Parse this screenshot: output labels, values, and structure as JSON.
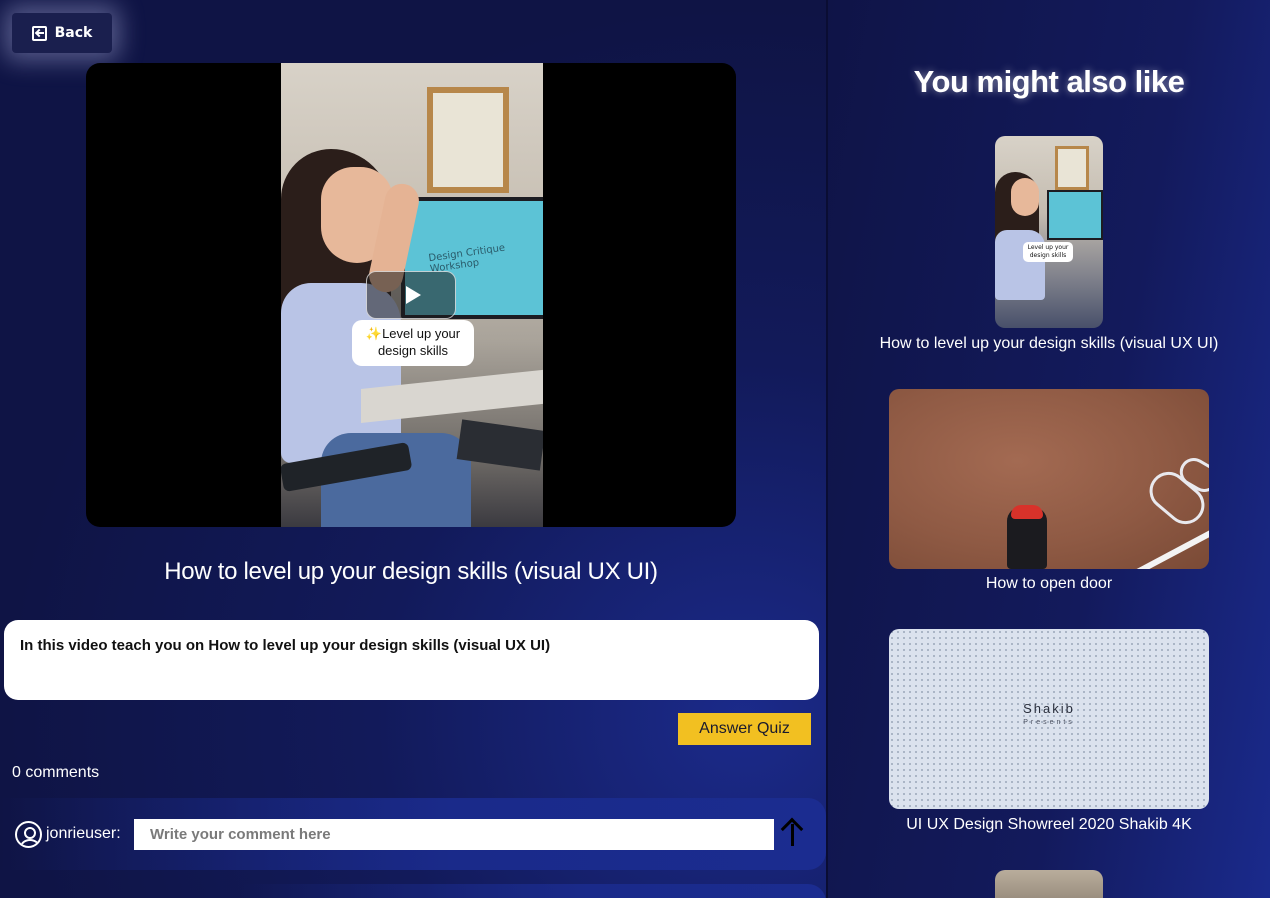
{
  "back_button": {
    "label": "Back",
    "icon": "arrow-left-square-icon"
  },
  "video": {
    "caption_emoji": "✨",
    "caption_text": "Level up your design skills",
    "monitor_text": "Design Critique Workshop",
    "title": "How to level up your design skills (visual UX UI)",
    "description": "In this video teach you on How to level up your design skills (visual UX UI)"
  },
  "quiz_button": {
    "label": "Answer Quiz",
    "color": "#f2c021"
  },
  "comments": {
    "count_text": "0 comments",
    "username": "jonrieuser:",
    "input_placeholder": "Write your comment here",
    "input_value": ""
  },
  "suggestions": {
    "title": "You might also like",
    "items": [
      {
        "label": "How to level up your design skills (visual UX UI)",
        "thumb_caption": "Level up your design skills"
      },
      {
        "label": "How to open door"
      },
      {
        "label": "UI UX Design Showreel 2020 Shakib 4K",
        "thumb_title": "Shakib",
        "thumb_subtitle": "Presents"
      },
      {
        "label": ""
      }
    ]
  },
  "colors": {
    "background": "#11164a",
    "accent_yellow": "#f2c021",
    "panel_white": "#ffffff"
  }
}
